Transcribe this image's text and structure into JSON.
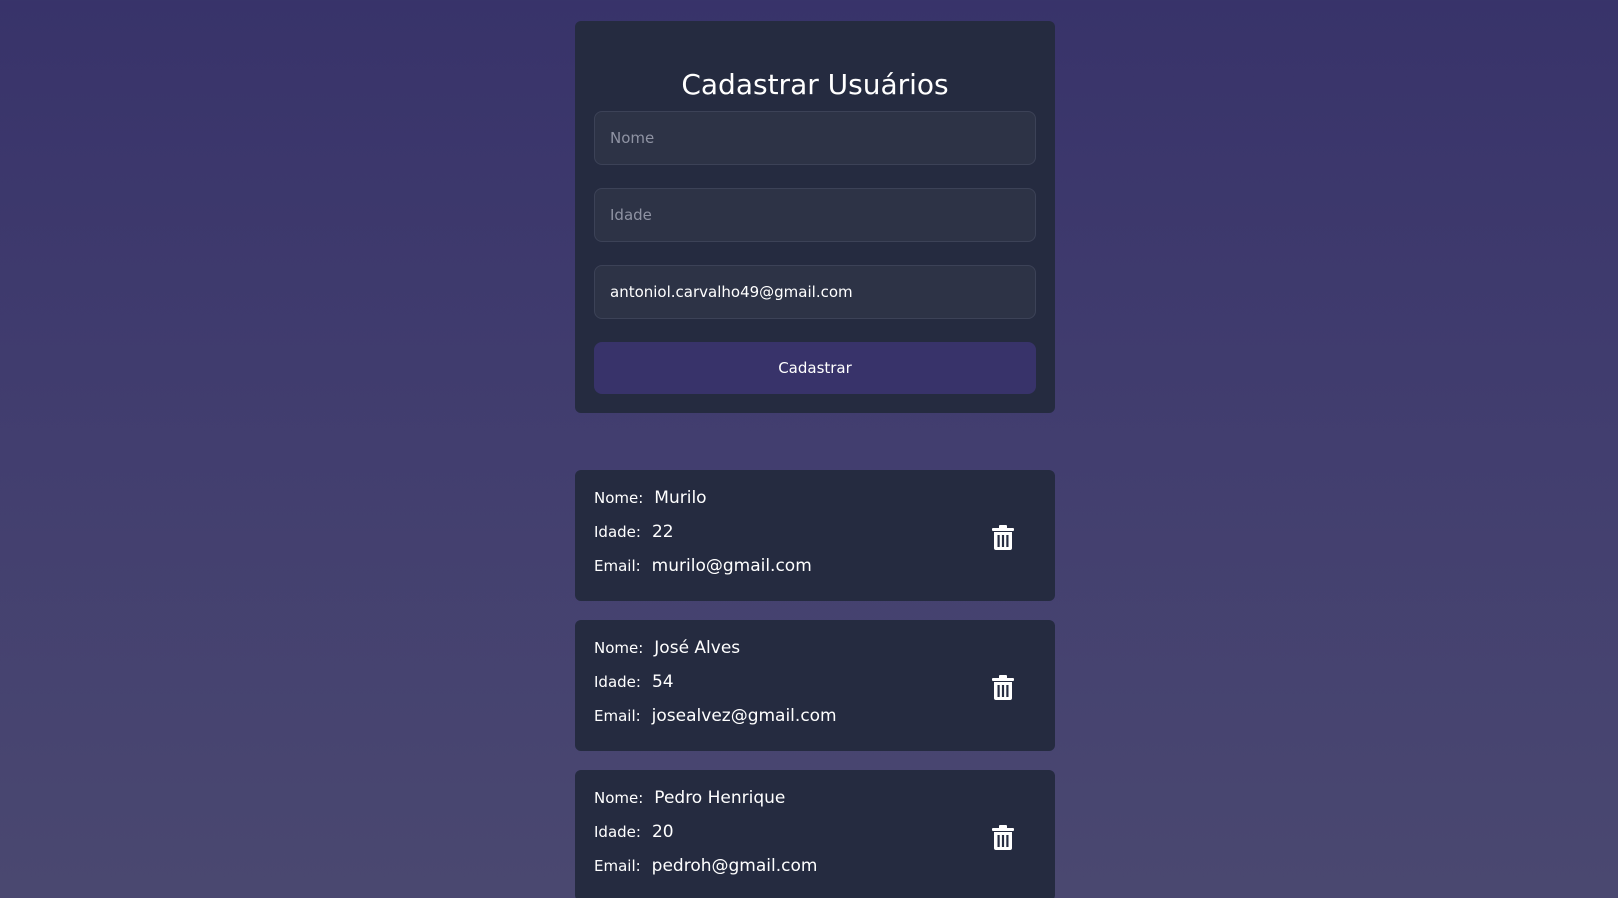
{
  "form": {
    "title": "Cadastrar Usuários",
    "nome_placeholder": "Nome",
    "idade_placeholder": "Idade",
    "email_value": "antoniol.carvalho49@gmail.com",
    "submit_label": "Cadastrar"
  },
  "labels": {
    "nome": "Nome:",
    "idade": "Idade:",
    "email": "Email:"
  },
  "users": [
    {
      "nome": "Murilo",
      "idade": "22",
      "email": "murilo@gmail.com"
    },
    {
      "nome": "José Alves",
      "idade": "54",
      "email": "josealvez@gmail.com"
    },
    {
      "nome": "Pedro Henrique",
      "idade": "20",
      "email": "pedroh@gmail.com"
    }
  ],
  "icons": {
    "delete": "trash-icon"
  },
  "colors": {
    "background_top": "#38336a",
    "background_bottom": "#4a4870",
    "card": "#252b40",
    "input": "#2d3346",
    "button": "#38336a"
  }
}
